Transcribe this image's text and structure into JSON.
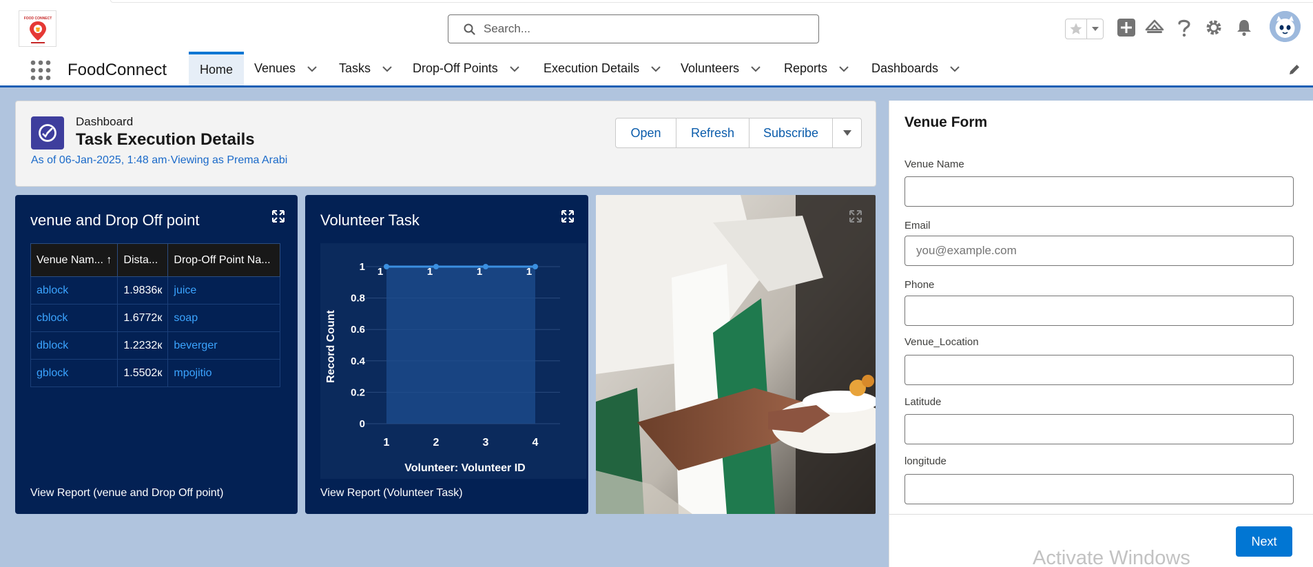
{
  "search": {
    "placeholder": "Search..."
  },
  "app": {
    "name": "FoodConnect",
    "logo_text": "FOOD CONNECT"
  },
  "nav": {
    "tabs": [
      {
        "label": "Home",
        "active": true,
        "has_menu": false
      },
      {
        "label": "Venues",
        "has_menu": true
      },
      {
        "label": "Tasks",
        "has_menu": true
      },
      {
        "label": "Drop-Off Points",
        "has_menu": true
      },
      {
        "label": "Execution Details",
        "has_menu": true
      },
      {
        "label": "Volunteers",
        "has_menu": true
      },
      {
        "label": "Reports",
        "has_menu": true
      },
      {
        "label": "Dashboards",
        "has_menu": true
      }
    ]
  },
  "dashboard": {
    "kicker": "Dashboard",
    "title": "Task Execution Details",
    "subtitle": "As of 06-Jan-2025, 1:48 am·Viewing as Prema Arabi",
    "buttons": {
      "open": "Open",
      "refresh": "Refresh",
      "subscribe": "Subscribe"
    }
  },
  "venue_card": {
    "title": "venue and Drop Off point",
    "columns": [
      "Venue Nam... ↑",
      "Dista...",
      "Drop-Off Point Na..."
    ],
    "rows": [
      [
        "ablock",
        "1.9836к",
        "juice"
      ],
      [
        "cblock",
        "1.6772к",
        "soap"
      ],
      [
        "dblock",
        "1.2232к",
        "beverger"
      ],
      [
        "gblock",
        "1.5502к",
        "mpojitio"
      ]
    ],
    "view_report": "View Report (venue and Drop Off point)"
  },
  "volunteer_card": {
    "title": "Volunteer Task",
    "view_report": "View Report (Volunteer Task)"
  },
  "chart_data": {
    "type": "area",
    "x": [
      "1",
      "2",
      "3",
      "4"
    ],
    "values": [
      1,
      1,
      1,
      1
    ],
    "data_labels": [
      "1",
      "1",
      "1",
      "1"
    ],
    "xlabel": "Volunteer: Volunteer ID",
    "ylabel": "Record Count",
    "yticks": [
      "0",
      "0.2",
      "0.4",
      "0.6",
      "0.8",
      "1"
    ],
    "ylim": [
      0,
      1
    ],
    "grid": true,
    "color": "#3b8fe0"
  },
  "form": {
    "title": "Venue Form",
    "fields": [
      {
        "label": "Venue Name",
        "value": "",
        "placeholder": ""
      },
      {
        "label": "Email",
        "value": "",
        "placeholder": "you@example.com"
      },
      {
        "label": "Phone",
        "value": "",
        "placeholder": ""
      },
      {
        "label": "Venue_Location",
        "value": "",
        "placeholder": ""
      },
      {
        "label": "Latitude",
        "value": "",
        "placeholder": ""
      },
      {
        "label": "longitude",
        "value": "",
        "placeholder": ""
      }
    ],
    "next": "Next"
  },
  "watermark": "Activate Windows",
  "colors": {
    "brand": "#0176d3",
    "nav_border": "#1b5fb4",
    "card_bg": "#032154",
    "page_bg": "#b0c4de"
  }
}
